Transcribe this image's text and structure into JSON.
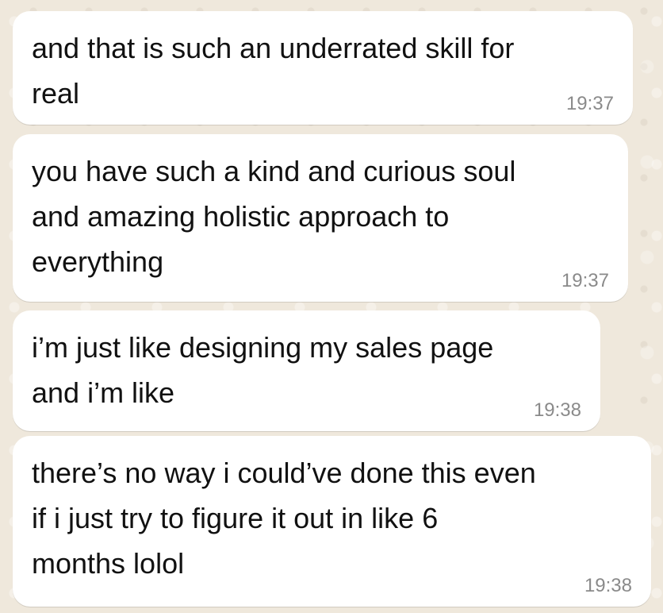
{
  "conversation": {
    "messages": [
      {
        "text": "and that is such an underrated skill for\nreal",
        "time": "19:37"
      },
      {
        "text": "you have such a kind and curious soul\nand amazing holistic approach to\neverything",
        "time": "19:37"
      },
      {
        "text": "i’m just like designing my sales page\nand i’m like",
        "time": "19:38"
      },
      {
        "text": "there’s no way i could’ve done this even\nif i just try to figure it out in like 6\nmonths lolol",
        "time": "19:38"
      }
    ]
  },
  "colors": {
    "background": "#efe8dc",
    "bubble": "#ffffff",
    "text": "#111111",
    "timestamp": "#8a8a8a"
  }
}
